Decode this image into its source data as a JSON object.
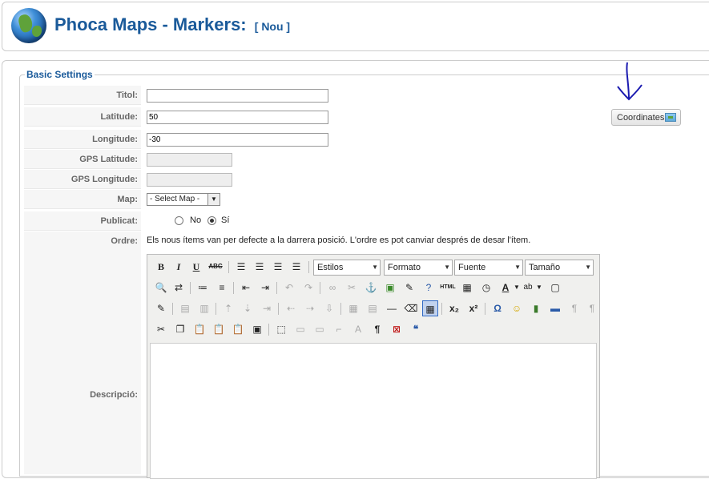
{
  "header": {
    "title": "Phoca Maps - Markers:",
    "subtitle": "[ Nou ]"
  },
  "fieldset": {
    "legend": "Basic Settings"
  },
  "form": {
    "titol": {
      "label": "Titol:",
      "value": ""
    },
    "latitude": {
      "label": "Latitude:",
      "value": "50"
    },
    "longitude": {
      "label": "Longitude:",
      "value": "-30"
    },
    "gps_latitude": {
      "label": "GPS Latitude:",
      "value": ""
    },
    "gps_longitude": {
      "label": "GPS Longitude:",
      "value": ""
    },
    "map": {
      "label": "Map:",
      "selected": "- Select Map -"
    },
    "publicat": {
      "label": "Publicat:",
      "options": [
        "No",
        "Sí"
      ],
      "selected": "Sí"
    },
    "ordre": {
      "label": "Ordre:",
      "text": "Els nous ítems van per defecte a la darrera posició. L'ordre es pot canviar després de desar l'ítem."
    },
    "descripcio": {
      "label": "Descripció:"
    }
  },
  "coordinates_button": {
    "label": "Coordinates",
    "icon": "map-icon"
  },
  "editor": {
    "dropdowns": {
      "styles": "Estilos",
      "format": "Formato",
      "font": "Fuente",
      "size": "Tamaño"
    },
    "labels": {
      "html": "HTML"
    }
  }
}
